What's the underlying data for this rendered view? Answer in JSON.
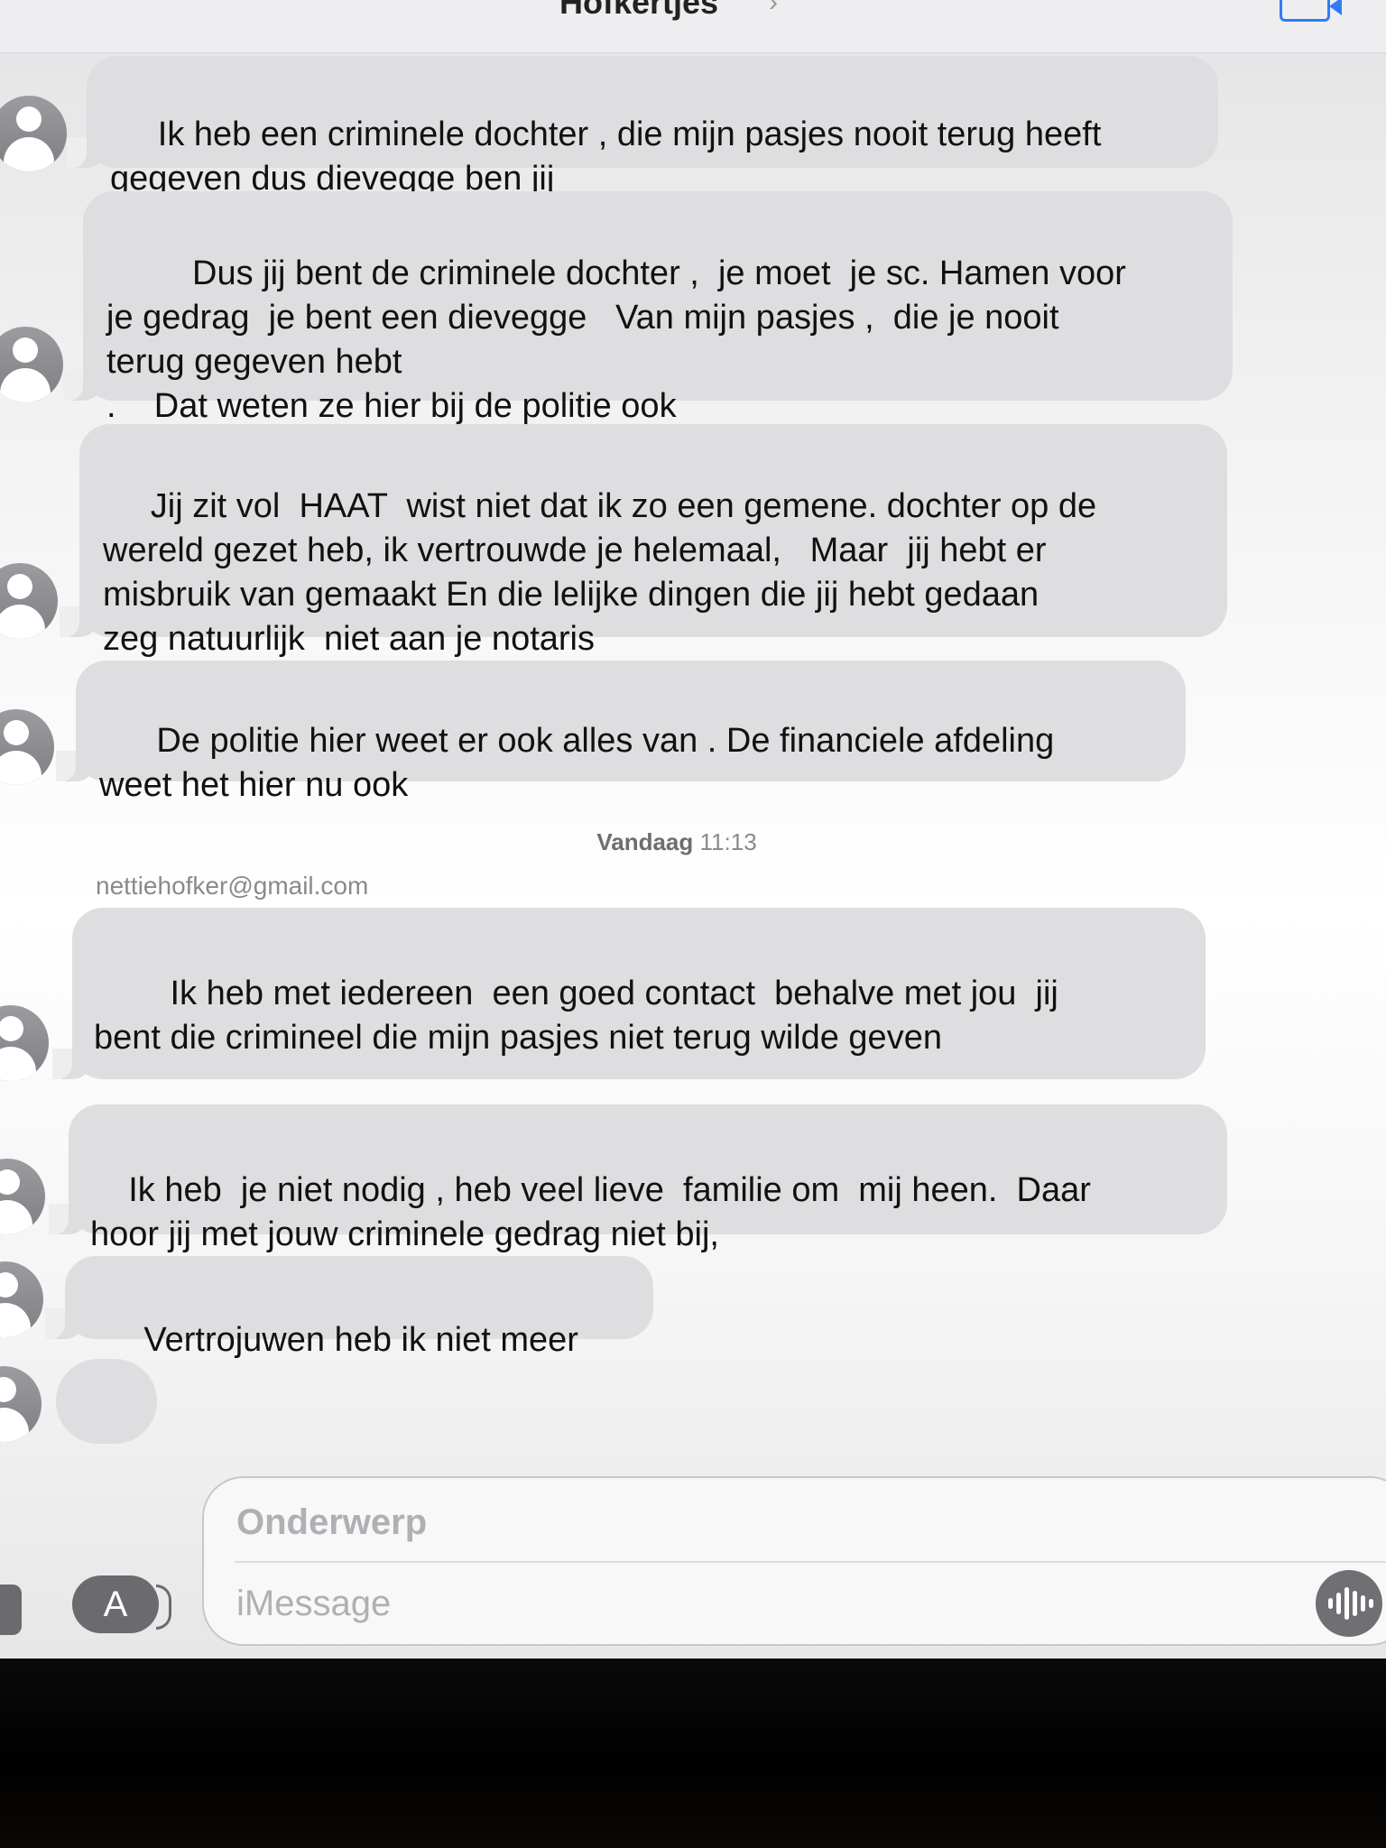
{
  "header": {
    "contact_name": "Hofkertjes",
    "chevron": "›",
    "video_icon": "video-camera-icon"
  },
  "conversation": {
    "messages_before": [
      {
        "text": " Ik heb een criminele dochter , die mijn pasjes nooit terug heeft\ngegeven dus dievegge ben jij"
      },
      {
        "text": "     Dus jij bent de criminele dochter ,  je moet  je sc. Hamen voor\nje gedrag  je bent een dievegge   Van mijn pasjes ,  die je nooit\nterug gegeven hebt\n.    Dat weten ze hier bij de politie ook"
      },
      {
        "text": " Jij zit vol  HAAT  wist niet dat ik zo een gemene. dochter op de\nwereld gezet heb, ik vertrouwde je helemaal,   Maar  jij hebt er\nmisbruik van gemaakt En die lelijke dingen die jij hebt gedaan\nzeg natuurlijk  niet aan je notaris"
      },
      {
        "text": "  De politie hier weet er ook alles van . De financiele afdeling\nweet het hier nu ook"
      }
    ],
    "timestamp_day": "Vandaag",
    "timestamp_time": "11:13",
    "sender": "nettiehofker@gmail.com",
    "messages_after": [
      {
        "text": "    Ik heb met iedereen  een goed contact  behalve met jou  jij\nbent die crimineel die mijn pasjes niet terug wilde geven"
      },
      {
        "text": "Ik heb  je niet nodig , heb veel lieve  familie om  mij heen.  Daar\nhoor jij met jouw criminele gedrag niet bij,"
      },
      {
        "text": "  Vertrojuwen heb ik niet meer"
      }
    ]
  },
  "compose": {
    "subject_placeholder": "Onderwerp",
    "message_placeholder": "iMessage",
    "apps_icon": "app-store-icon",
    "audio_icon": "audio-waveform-icon"
  }
}
